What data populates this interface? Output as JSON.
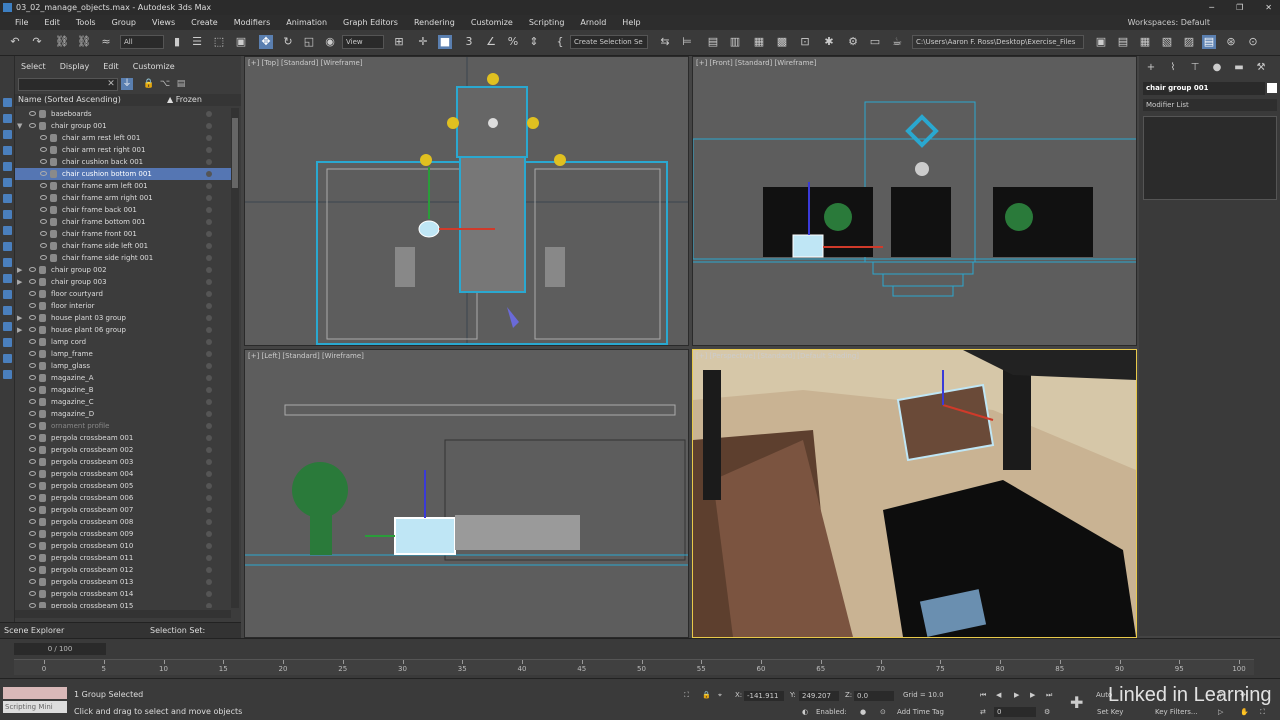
{
  "window": {
    "title": "03_02_manage_objects.max - Autodesk 3ds Max"
  },
  "menu": [
    "File",
    "Edit",
    "Tools",
    "Group",
    "Views",
    "Create",
    "Modifiers",
    "Animation",
    "Graph Editors",
    "Rendering",
    "Customize",
    "Scripting",
    "Arnold",
    "Help"
  ],
  "workspace": "Workspaces: Default",
  "toolbar": {
    "filter_all": "All",
    "view": "View",
    "selection_set": "Create Selection Se",
    "path": "C:\\Users\\Aaron F. Ross\\Desktop\\Exercise_Files"
  },
  "scene_explorer": {
    "tabs": [
      "Select",
      "Display",
      "Edit",
      "Customize"
    ],
    "col_name": "Name (Sorted Ascending)",
    "col_frozen": "▲ Frozen",
    "items": [
      {
        "label": "baseboards",
        "indent": 0,
        "exp": ""
      },
      {
        "label": "chair group 001",
        "indent": 0,
        "exp": "▼"
      },
      {
        "label": "chair arm rest left 001",
        "indent": 1,
        "exp": ""
      },
      {
        "label": "chair arm rest right 001",
        "indent": 1,
        "exp": ""
      },
      {
        "label": "chair cushion back 001",
        "indent": 1,
        "exp": ""
      },
      {
        "label": "chair cushion bottom 001",
        "indent": 1,
        "exp": "",
        "selected": true
      },
      {
        "label": "chair frame arm left 001",
        "indent": 1,
        "exp": ""
      },
      {
        "label": "chair frame arm right 001",
        "indent": 1,
        "exp": ""
      },
      {
        "label": "chair frame back 001",
        "indent": 1,
        "exp": ""
      },
      {
        "label": "chair frame bottom 001",
        "indent": 1,
        "exp": ""
      },
      {
        "label": "chair frame front 001",
        "indent": 1,
        "exp": ""
      },
      {
        "label": "chair frame side left 001",
        "indent": 1,
        "exp": ""
      },
      {
        "label": "chair frame side right 001",
        "indent": 1,
        "exp": ""
      },
      {
        "label": "chair group 002",
        "indent": 0,
        "exp": "▶"
      },
      {
        "label": "chair group 003",
        "indent": 0,
        "exp": "▶"
      },
      {
        "label": "floor courtyard",
        "indent": 0,
        "exp": ""
      },
      {
        "label": "floor interior",
        "indent": 0,
        "exp": ""
      },
      {
        "label": "house plant 03 group",
        "indent": 0,
        "exp": "▶"
      },
      {
        "label": "house plant 06 group",
        "indent": 0,
        "exp": "▶"
      },
      {
        "label": "lamp cord",
        "indent": 0,
        "exp": ""
      },
      {
        "label": "lamp_frame",
        "indent": 0,
        "exp": ""
      },
      {
        "label": "lamp_glass",
        "indent": 0,
        "exp": ""
      },
      {
        "label": "magazine_A",
        "indent": 0,
        "exp": ""
      },
      {
        "label": "magazine_B",
        "indent": 0,
        "exp": ""
      },
      {
        "label": "magazine_C",
        "indent": 0,
        "exp": ""
      },
      {
        "label": "magazine_D",
        "indent": 0,
        "exp": ""
      },
      {
        "label": "ornament profile",
        "indent": 0,
        "exp": "",
        "dim": true
      },
      {
        "label": "pergola crossbeam 001",
        "indent": 0,
        "exp": ""
      },
      {
        "label": "pergola crossbeam 002",
        "indent": 0,
        "exp": ""
      },
      {
        "label": "pergola crossbeam 003",
        "indent": 0,
        "exp": ""
      },
      {
        "label": "pergola crossbeam 004",
        "indent": 0,
        "exp": ""
      },
      {
        "label": "pergola crossbeam 005",
        "indent": 0,
        "exp": ""
      },
      {
        "label": "pergola crossbeam 006",
        "indent": 0,
        "exp": ""
      },
      {
        "label": "pergola crossbeam 007",
        "indent": 0,
        "exp": ""
      },
      {
        "label": "pergola crossbeam 008",
        "indent": 0,
        "exp": ""
      },
      {
        "label": "pergola crossbeam 009",
        "indent": 0,
        "exp": ""
      },
      {
        "label": "pergola crossbeam 010",
        "indent": 0,
        "exp": ""
      },
      {
        "label": "pergola crossbeam 011",
        "indent": 0,
        "exp": ""
      },
      {
        "label": "pergola crossbeam 012",
        "indent": 0,
        "exp": ""
      },
      {
        "label": "pergola crossbeam 013",
        "indent": 0,
        "exp": ""
      },
      {
        "label": "pergola crossbeam 014",
        "indent": 0,
        "exp": ""
      },
      {
        "label": "pergola crossbeam 015",
        "indent": 0,
        "exp": ""
      }
    ],
    "footer_left": "Scene Explorer",
    "footer_right": "Selection Set:"
  },
  "viewports": {
    "top": "[+] [Top] [Standard] [Wireframe]",
    "front": "[+] [Front] [Standard] [Wireframe]",
    "left": "[+] [Left] [Standard] [Wireframe]",
    "persp": "[+] [Perspective] [Standard] [Default Shading]"
  },
  "command_panel": {
    "object_name": "chair group 001",
    "modifier_list": "Modifier List"
  },
  "timeline": {
    "frame": "0 / 100",
    "ticks": [
      0,
      5,
      10,
      15,
      20,
      25,
      30,
      35,
      40,
      45,
      50,
      55,
      60,
      65,
      70,
      75,
      80,
      85,
      90,
      95,
      100
    ]
  },
  "status": {
    "script": "Scripting Mini",
    "selected": "1 Group Selected",
    "prompt": "Click and drag to select and move objects",
    "x": "-141.911",
    "y": "249.207",
    "z": "0.0",
    "x_label": "X:",
    "y_label": "Y:",
    "z_label": "Z:",
    "grid": "Grid = 10.0",
    "enabled": "Enabled:",
    "add_time_tag": "Add Time Tag",
    "set_key": "Set Key",
    "key_filters": "Key Filters...",
    "frame_field": "0",
    "auto": "Auto"
  },
  "watermark": "Linked in Learning"
}
